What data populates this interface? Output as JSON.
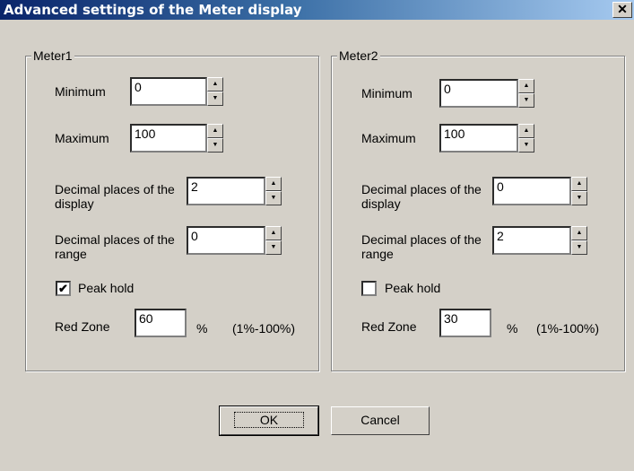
{
  "window": {
    "title": "Advanced settings of the Meter display",
    "close_glyph": "✕"
  },
  "meter1": {
    "legend": "Meter1",
    "minimum_label": "Minimum",
    "minimum_value": "0",
    "maximum_label": "Maximum",
    "maximum_value": "100",
    "decimal_display_label": "Decimal places of the display",
    "decimal_display_value": "2",
    "decimal_range_label": "Decimal places of the range",
    "decimal_range_value": "0",
    "peak_hold_label": "Peak hold",
    "peak_hold_checked": true,
    "red_zone_label": "Red Zone",
    "red_zone_value": "60",
    "percent_label": "%",
    "range_hint": "(1%-100%)"
  },
  "meter2": {
    "legend": "Meter2",
    "minimum_label": "Minimum",
    "minimum_value": "0",
    "maximum_label": "Maximum",
    "maximum_value": "100",
    "decimal_display_label": "Decimal places of the display",
    "decimal_display_value": "0",
    "decimal_range_label": "Decimal places of the range",
    "decimal_range_value": "2",
    "peak_hold_label": "Peak hold",
    "peak_hold_checked": false,
    "red_zone_label": "Red Zone",
    "red_zone_value": "30",
    "percent_label": "%",
    "range_hint": "(1%-100%)"
  },
  "buttons": {
    "ok": "OK",
    "cancel": "Cancel"
  },
  "icons": {
    "spin_up": "up-arrow-icon",
    "spin_down": "down-arrow-icon",
    "check": "checkmark-icon"
  }
}
